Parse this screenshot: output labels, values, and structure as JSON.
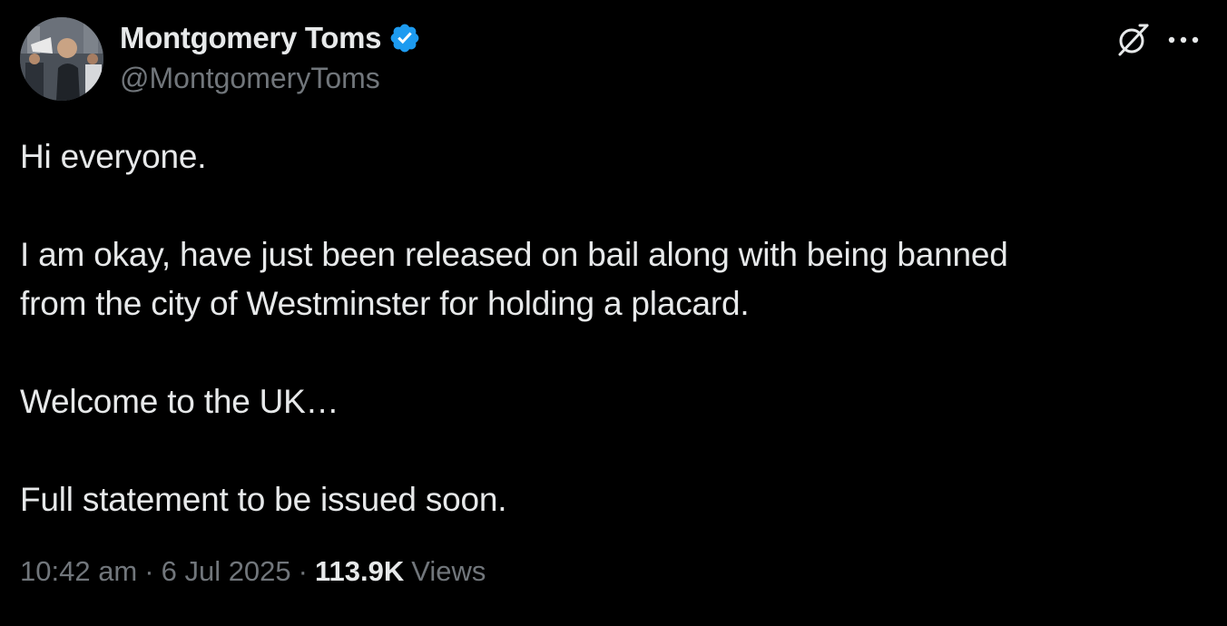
{
  "author": {
    "display_name": "Montgomery Toms",
    "handle": "@MontgomeryToms",
    "verified": true
  },
  "tweet": {
    "paragraphs": [
      "Hi everyone.",
      "I am okay, have just been released on bail along with being banned\nfrom the city of Westminster for holding a placard.",
      "Welcome to the UK…",
      "Full statement to be issued soon."
    ],
    "time": "10:42 am",
    "separator": "·",
    "date": "6 Jul 2025",
    "views_count": "113.9K",
    "views_label": "Views"
  },
  "icons": {
    "verified": "verified-badge-icon",
    "grok": "grok-icon",
    "more": "more-options-icon"
  },
  "colors": {
    "background": "#000000",
    "text_primary": "#e7e9ea",
    "text_secondary": "#71767b",
    "verified_blue": "#1d9bf0"
  }
}
